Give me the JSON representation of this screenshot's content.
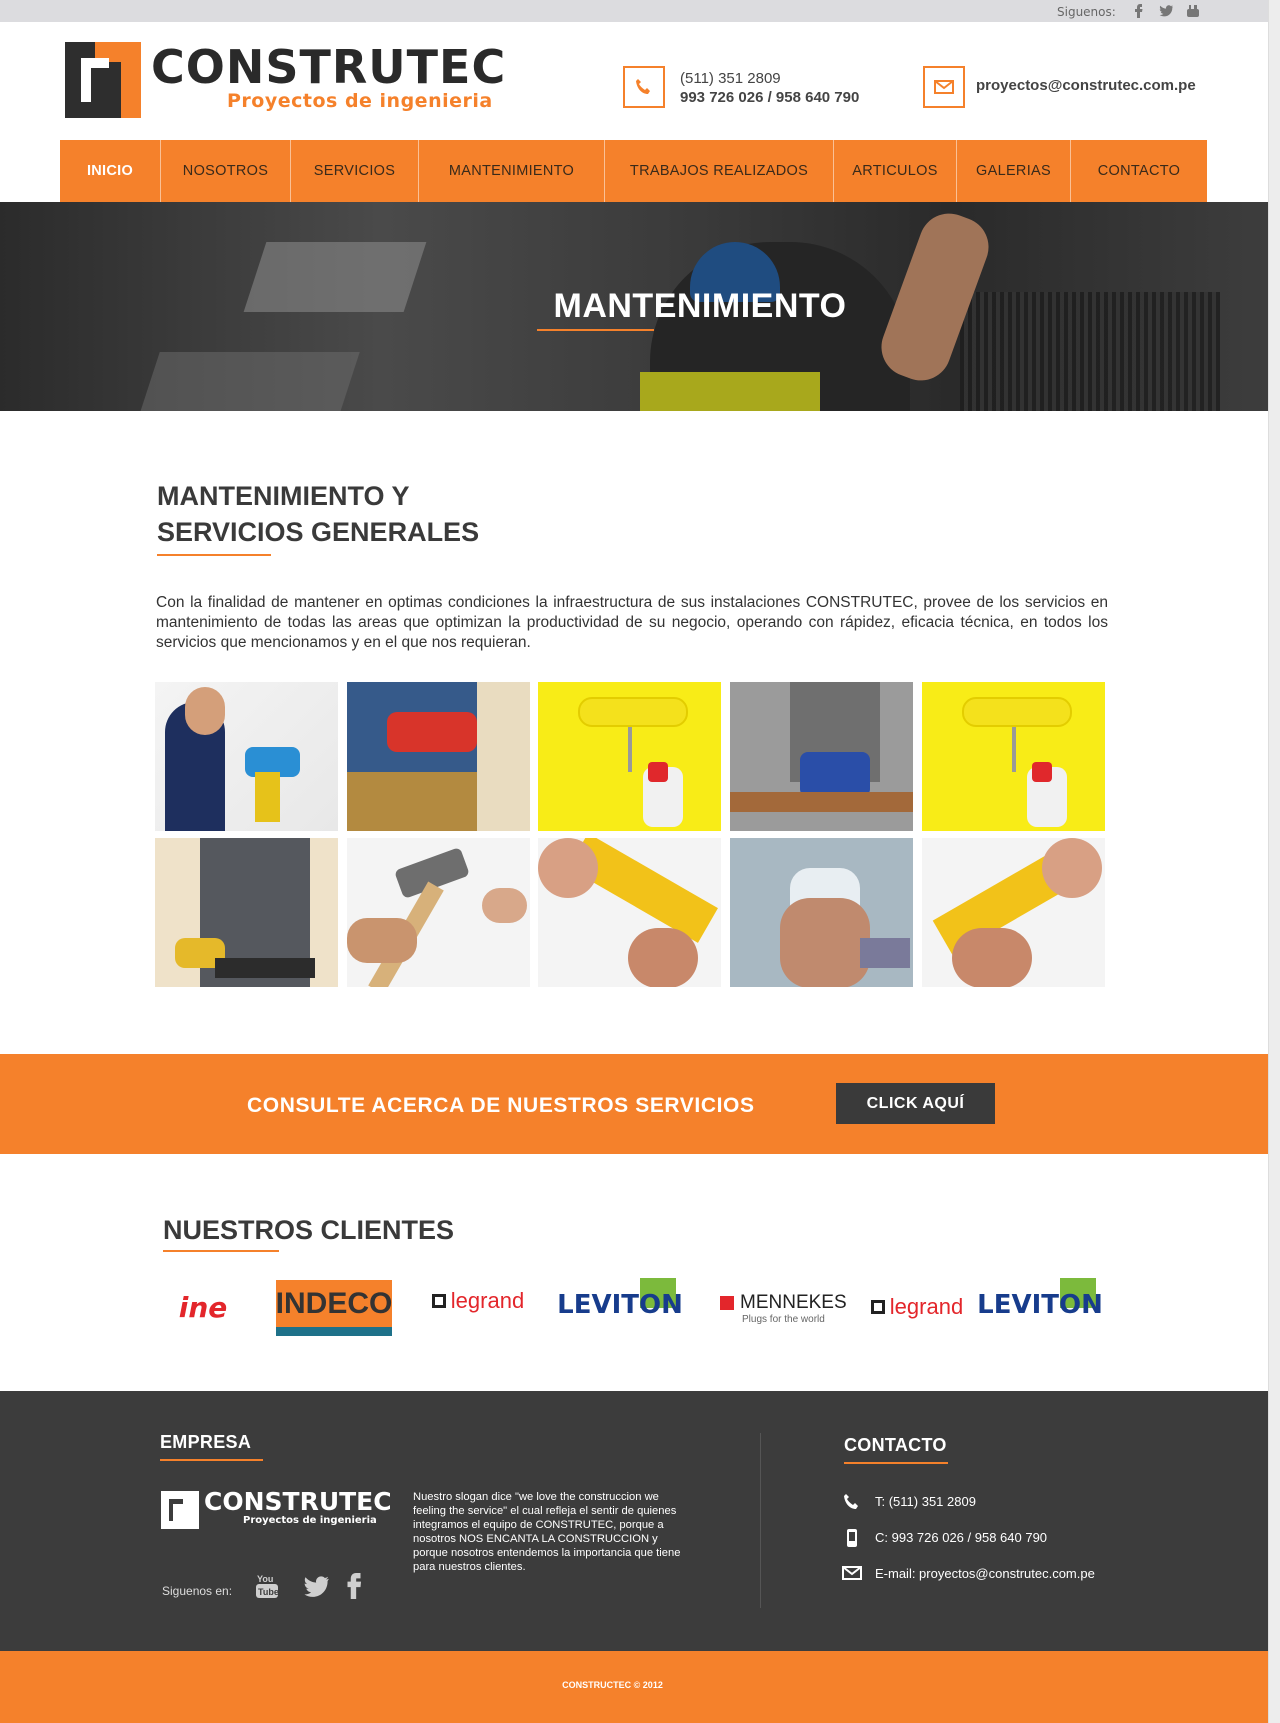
{
  "topbar": {
    "follow_label": "Siguenos:",
    "icons": [
      "facebook-icon",
      "twitter-icon",
      "youtube-icon"
    ]
  },
  "header": {
    "logo_name": "CONSTRUTEC",
    "logo_subtitle": "Proyectos de ingenieria",
    "phone_line1": "(511) 351 2809",
    "phone_line2": "993 726 026 / 958 640 790",
    "email": "proyectos@construtec.com.pe"
  },
  "nav": {
    "items": [
      {
        "label": "INICIO",
        "active": true
      },
      {
        "label": "NOSOTROS",
        "active": false
      },
      {
        "label": "SERVICIOS",
        "active": false
      },
      {
        "label": "MANTENIMIENTO",
        "active": false
      },
      {
        "label": "TRABAJOS REALIZADOS",
        "active": false
      },
      {
        "label": "ARTICULOS",
        "active": false
      },
      {
        "label": "GALERIAS",
        "active": false
      },
      {
        "label": "CONTACTO",
        "active": false
      }
    ]
  },
  "hero": {
    "title": "MANTENIMIENTO"
  },
  "content": {
    "title_line1": "MANTENIMIENTO Y",
    "title_line2": "SERVICIOS GENERALES",
    "intro": "Con la finalidad de mantener en optimas condiciones la infraestructura de sus instalaciones CONSTRUTEC, provee de los servicios en mantenimiento de todas las areas que optimizan la productividad de su negocio, operando con rápidez, eficacia técnica, en todos los servicios que mencionamos y en el que nos requieran."
  },
  "gallery": [
    "drill-worker-photo",
    "toolbelt-drill-photo",
    "paint-roller-photo",
    "jigsaw-photo",
    "paint-roller-photo",
    "worker-toolbelt-photo",
    "hammer-photo",
    "ruler-pencil-photo",
    "plaster-wall-photo",
    "ruler-pencil-photo"
  ],
  "cta": {
    "text": "CONSULTE ACERCA DE NUESTROS SERVICIOS",
    "button": "CLICK AQUÍ"
  },
  "clients": {
    "title": "NUESTROS CLIENTES",
    "logos": [
      {
        "name": "ine-logo",
        "text": "ine"
      },
      {
        "name": "indeco-logo",
        "text": "INDECO"
      },
      {
        "name": "legrand-logo",
        "text": "legrand"
      },
      {
        "name": "leviton-logo",
        "text": "LEVITON"
      },
      {
        "name": "mennekes-logo",
        "text": "MENNEKES",
        "tagline": "Plugs for the world"
      },
      {
        "name": "legrand-logo",
        "text": "legrand"
      },
      {
        "name": "leviton-logo",
        "text": "LEVITON"
      }
    ]
  },
  "footer": {
    "empresa_title": "EMPRESA",
    "logo_name": "CONSTRUTEC",
    "logo_subtitle": "Proyectos de ingenieria",
    "slogan": "Nuestro slogan dice \"we love the construccion we feeling the service\" el cual refleja el sentir de quienes integramos el equipo de CONSTRUTEC, porque a nosotros NOS ENCANTA LA CONSTRUCCION y porque nosotros entendemos la importancia que tiene para nuestros clientes.",
    "follow_label": "Siguenos en:",
    "contact_title": "CONTACTO",
    "phone": "T: (511) 351 2809",
    "cell": "C: 993 726 026 / 958 640 790",
    "email": "E-mail: proyectos@construtec.com.pe",
    "copyright": "CONSTRUCTEC © 2012"
  },
  "colors": {
    "accent": "#f5812b",
    "dark": "#3c3c3c"
  }
}
